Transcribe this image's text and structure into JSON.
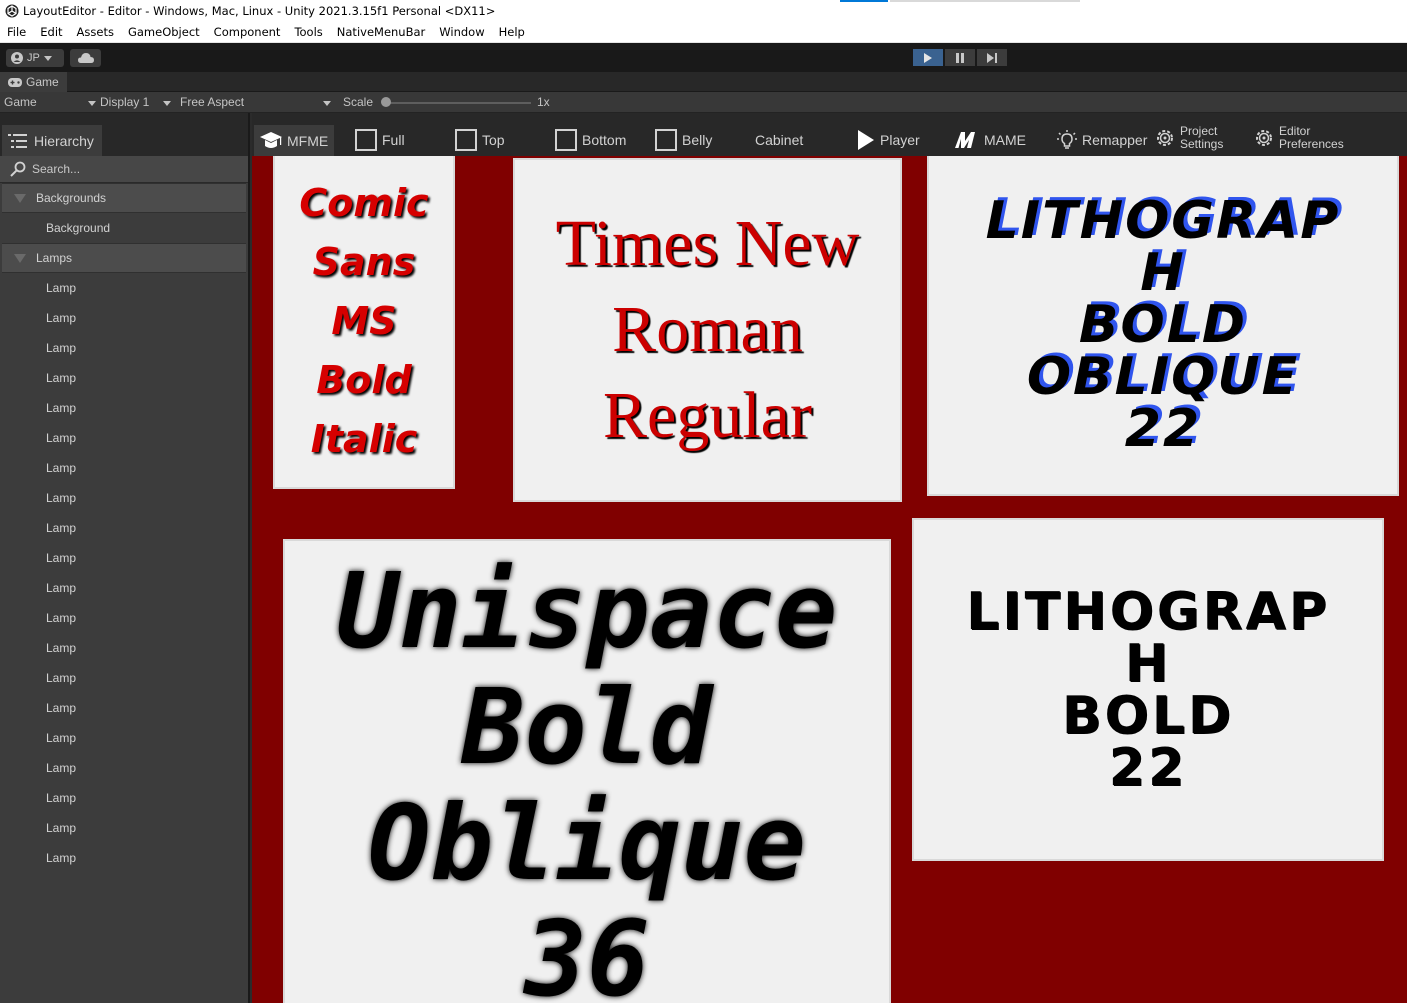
{
  "window": {
    "title": "LayoutEditor - Editor - Windows, Mac, Linux - Unity 2021.3.15f1 Personal <DX11>"
  },
  "menubar": {
    "items": [
      "File",
      "Edit",
      "Assets",
      "GameObject",
      "Component",
      "Tools",
      "NativeMenuBar",
      "Window",
      "Help"
    ]
  },
  "toolbar": {
    "account_label": "JP"
  },
  "game_view": {
    "tab_label": "Game",
    "mode": "Game",
    "display": "Display 1",
    "aspect": "Free Aspect",
    "scale_label": "Scale",
    "scale_value": "1x"
  },
  "hierarchy": {
    "tab_label": "Hierarchy",
    "search_placeholder": "Search...",
    "groups": [
      {
        "label": "Backgrounds",
        "children": [
          "Background"
        ]
      },
      {
        "label": "Lamps",
        "children": [
          "Lamp",
          "Lamp",
          "Lamp",
          "Lamp",
          "Lamp",
          "Lamp",
          "Lamp",
          "Lamp",
          "Lamp",
          "Lamp",
          "Lamp",
          "Lamp",
          "Lamp",
          "Lamp",
          "Lamp",
          "Lamp",
          "Lamp",
          "Lamp",
          "Lamp",
          "Lamp"
        ]
      }
    ]
  },
  "layout_toolbar": {
    "mfme": "MFME",
    "full": "Full",
    "top": "Top",
    "bottom": "Bottom",
    "belly": "Belly",
    "cabinet": "Cabinet",
    "player": "Player",
    "mame": "MAME",
    "remapper": "Remapper",
    "project_settings_1": "Project",
    "project_settings_2": "Settings",
    "editor_prefs_1": "Editor",
    "editor_prefs_2": "Preferences"
  },
  "canvas": {
    "background_color": "#800000",
    "panel1": [
      "Comic",
      "Sans",
      "MS",
      "Bold",
      "Italic"
    ],
    "panel2": [
      "Times New",
      "Roman",
      "Regular"
    ],
    "panel3": [
      "LITHOGRAP",
      "H",
      "BOLD",
      "OBLIQUE",
      "22"
    ],
    "panel4": [
      "Unispace",
      "Bold",
      "Oblique",
      "36"
    ],
    "panel5": [
      "LITHOGRAP",
      "H",
      "BOLD",
      "22"
    ]
  }
}
